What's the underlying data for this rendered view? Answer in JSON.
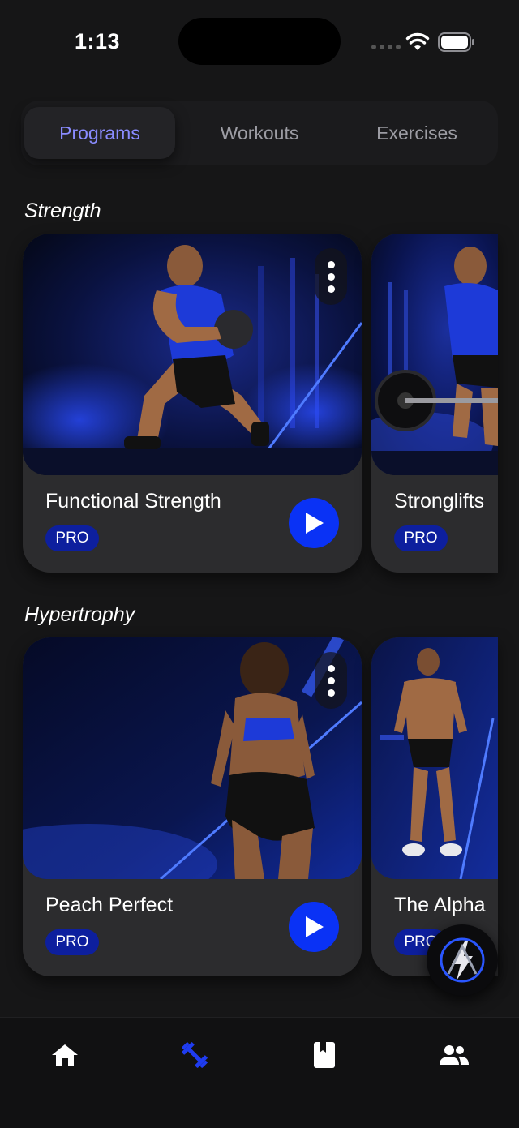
{
  "status_bar": {
    "time": "1:13",
    "wifi_icon": "wifi-icon",
    "battery_icon": "battery-icon"
  },
  "tabs": [
    {
      "label": "Programs",
      "active": true
    },
    {
      "label": "Workouts",
      "active": false
    },
    {
      "label": "Exercises",
      "active": false
    }
  ],
  "sections": [
    {
      "title": "Strength",
      "cards": [
        {
          "title": "Functional Strength",
          "badge": "PRO"
        },
        {
          "title": "Stronglifts",
          "badge": "PRO"
        }
      ]
    },
    {
      "title": "Hypertrophy",
      "cards": [
        {
          "title": "Peach Perfect",
          "badge": "PRO"
        },
        {
          "title": "The Alpha",
          "badge": "PRO"
        }
      ]
    }
  ],
  "colors": {
    "accent": "#8a8cff",
    "play": "#0a32f5",
    "badge": "#0d1f9e",
    "nav_active": "#1f3cf0",
    "background": "#161617",
    "card": "#2c2c2e"
  },
  "bottom_nav": [
    {
      "icon": "home-icon",
      "active": false
    },
    {
      "icon": "dumbbell-icon",
      "active": true
    },
    {
      "icon": "book-icon",
      "active": false
    },
    {
      "icon": "people-icon",
      "active": false
    }
  ]
}
